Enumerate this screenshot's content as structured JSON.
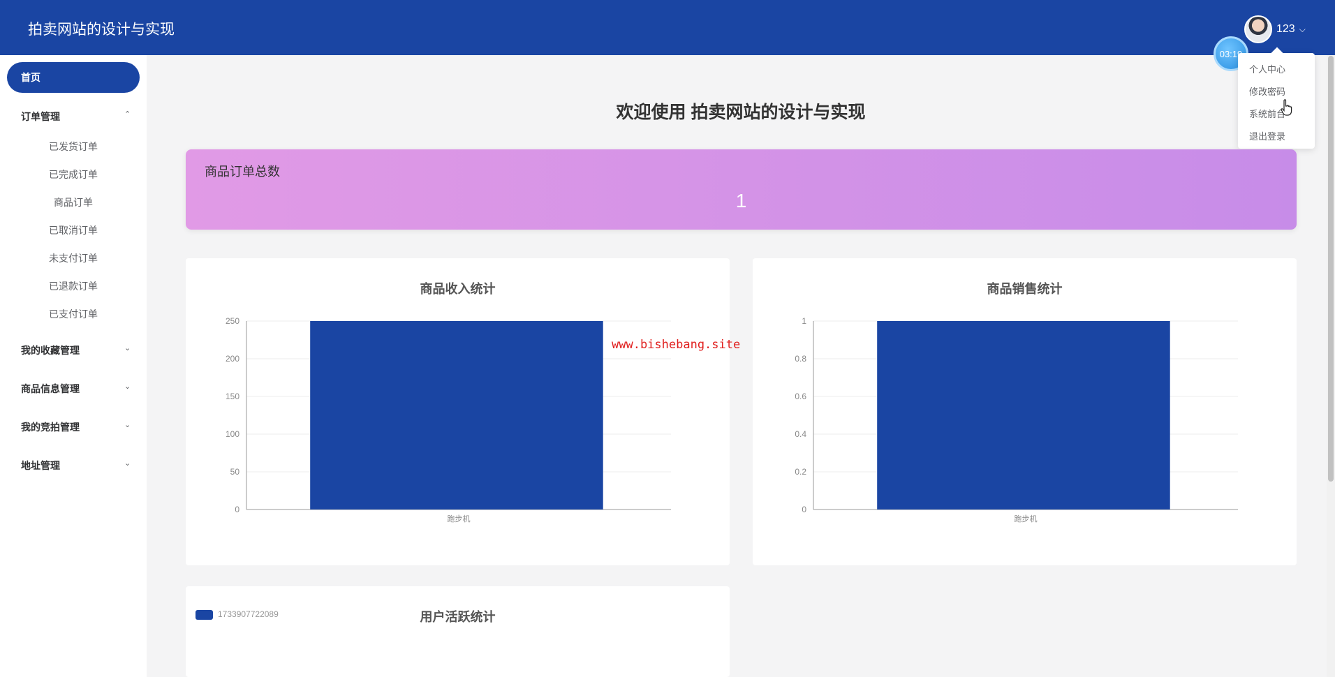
{
  "header": {
    "title": "拍卖网站的设计与实现",
    "user_name": "123",
    "caret": "⌵",
    "avatar_icon": "avatar-icon"
  },
  "timer": "03:19",
  "user_menu": [
    "个人中心",
    "修改密码",
    "系统前台",
    "退出登录"
  ],
  "sidebar": {
    "home": "首页",
    "groups": [
      {
        "label": "订单管理",
        "chevron": "⌃",
        "expanded": true,
        "items": [
          "已发货订单",
          "已完成订单",
          "商品订单",
          "已取消订单",
          "未支付订单",
          "已退款订单",
          "已支付订单"
        ]
      },
      {
        "label": "我的收藏管理",
        "chevron": "⌄",
        "expanded": false
      },
      {
        "label": "商品信息管理",
        "chevron": "⌄",
        "expanded": false
      },
      {
        "label": "我的竞拍管理",
        "chevron": "⌄",
        "expanded": false
      },
      {
        "label": "地址管理",
        "chevron": "⌄",
        "expanded": false
      }
    ]
  },
  "main": {
    "welcome": "欢迎使用 拍卖网站的设计与实现",
    "stat": {
      "label": "商品订单总数",
      "value": "1"
    },
    "watermark": "www.bishebang.site",
    "activity": {
      "title": "用户活跃统计",
      "legend": "1733907722089"
    }
  },
  "colors": {
    "accent": "#1a45a3",
    "card_gradient_start": "#e19ae6",
    "card_gradient_end": "#c78ce8"
  },
  "chart_data": [
    {
      "type": "bar",
      "title": "商品收入统计",
      "categories": [
        "跑步机"
      ],
      "values": [
        250
      ],
      "ylim": [
        0,
        250
      ],
      "yticks": [
        0,
        50,
        100,
        150,
        200,
        250
      ],
      "grid": true
    },
    {
      "type": "bar",
      "title": "商品销售统计",
      "categories": [
        "跑步机"
      ],
      "values": [
        1
      ],
      "ylim": [
        0,
        1
      ],
      "yticks": [
        0,
        0.2,
        0.4,
        0.6,
        0.8,
        1
      ],
      "grid": true
    }
  ]
}
